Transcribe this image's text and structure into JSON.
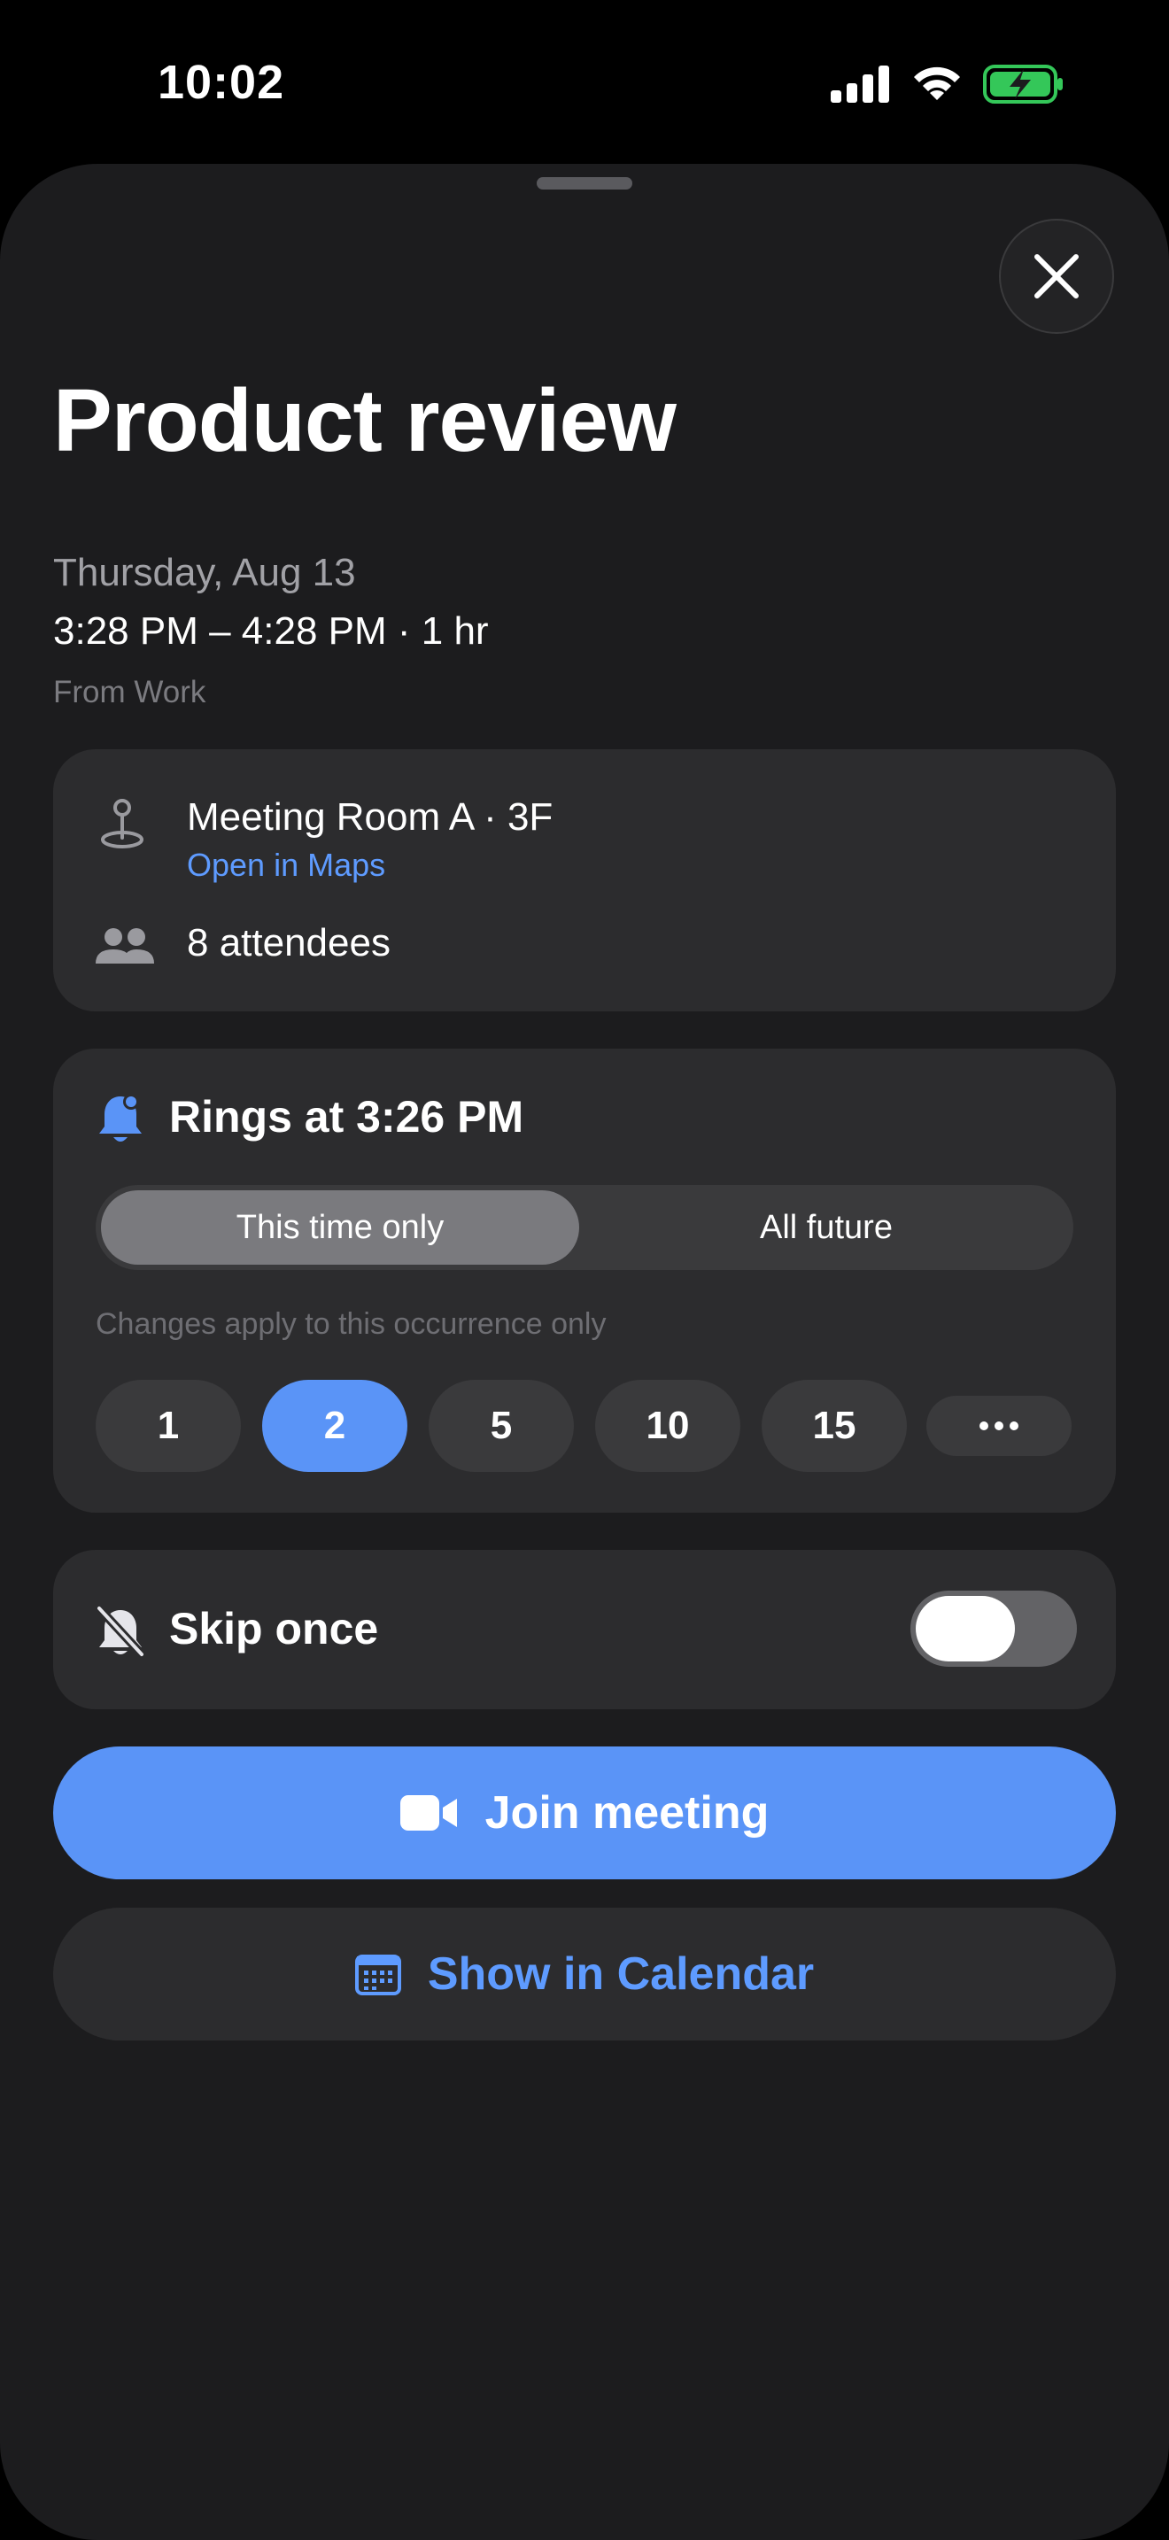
{
  "status_bar": {
    "time": "10:02",
    "icons": [
      "cellular-signal-icon",
      "wifi-icon",
      "battery-charging-icon"
    ],
    "battery_color": "#34c759"
  },
  "event": {
    "title": "Product review",
    "date": "Thursday, Aug 13",
    "time_range": "3:28 PM – 4:28 PM · 1 hr",
    "calendar": "From Work"
  },
  "details": {
    "location": "Meeting Room A · 3F",
    "maps_link": "Open in Maps",
    "attendees": "8 attendees"
  },
  "alarm": {
    "title": "Rings at 3:26 PM",
    "segments": [
      "This time only",
      "All future"
    ],
    "selected_segment": "This time only",
    "hint": "Changes apply to this occurrence only",
    "chips": [
      "1",
      "2",
      "5",
      "10",
      "15"
    ],
    "selected_chip": "2",
    "more_icon": "ellipsis-icon"
  },
  "skip": {
    "label": "Skip once",
    "enabled": false
  },
  "actions": {
    "join_label": "Join meeting",
    "calendar_label": "Show in Calendar"
  },
  "colors": {
    "accent": "#5a94f7",
    "link": "#5e9bff",
    "sheet_bg": "#1c1c1e",
    "card_bg": "#2c2c2e"
  }
}
